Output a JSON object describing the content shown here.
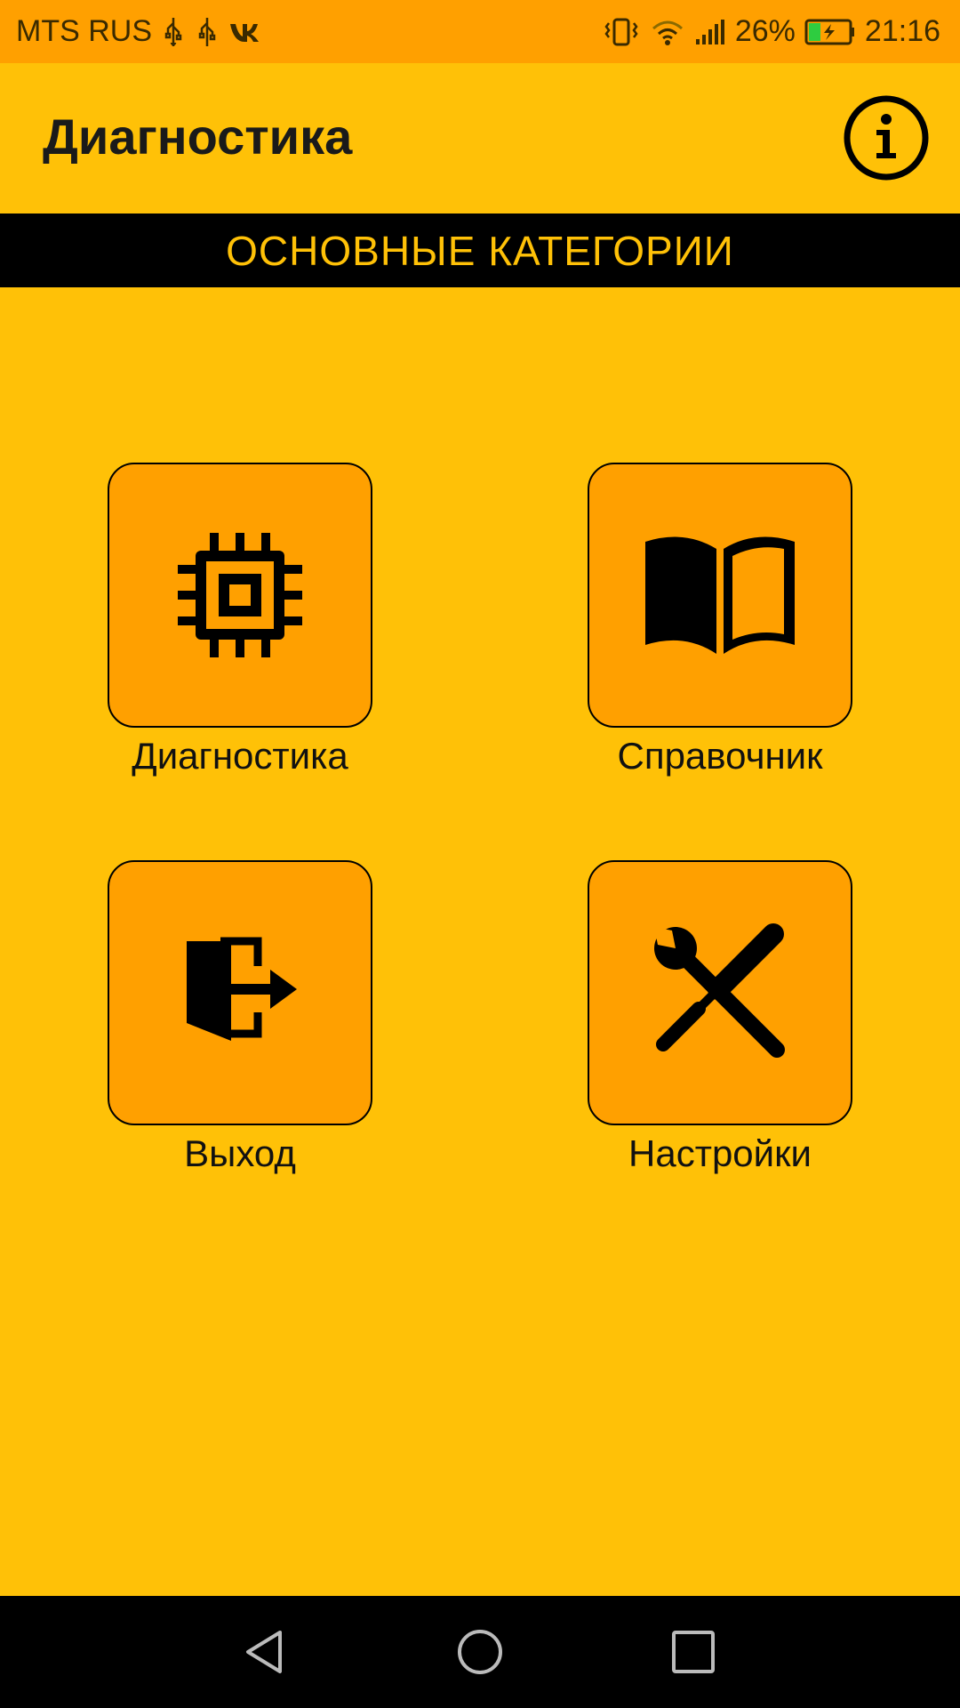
{
  "status_bar": {
    "carrier": "MTS RUS",
    "battery_percent": "26%",
    "time": "21:16",
    "icons": [
      "usb-icon",
      "usb-icon",
      "vk-icon",
      "vibrate-icon",
      "wifi-icon",
      "signal-icon",
      "battery-charging-icon"
    ]
  },
  "app_bar": {
    "title": "Диагностика",
    "info_icon": "info-icon"
  },
  "section": {
    "title": "ОСНОВНЫЕ КАТЕГОРИИ"
  },
  "tiles": [
    {
      "label": "Диагностика",
      "icon": "chip-icon"
    },
    {
      "label": "Справочник",
      "icon": "book-icon"
    },
    {
      "label": "Выход",
      "icon": "exit-icon"
    },
    {
      "label": "Настройки",
      "icon": "tools-icon"
    }
  ],
  "nav_bar": {
    "buttons": [
      "back-icon",
      "home-icon",
      "recents-icon"
    ]
  },
  "colors": {
    "background": "#FFC107",
    "status_bar": "#FFA000",
    "tile": "#FFA000",
    "header_bg": "#000000",
    "header_text": "#FFC107"
  }
}
